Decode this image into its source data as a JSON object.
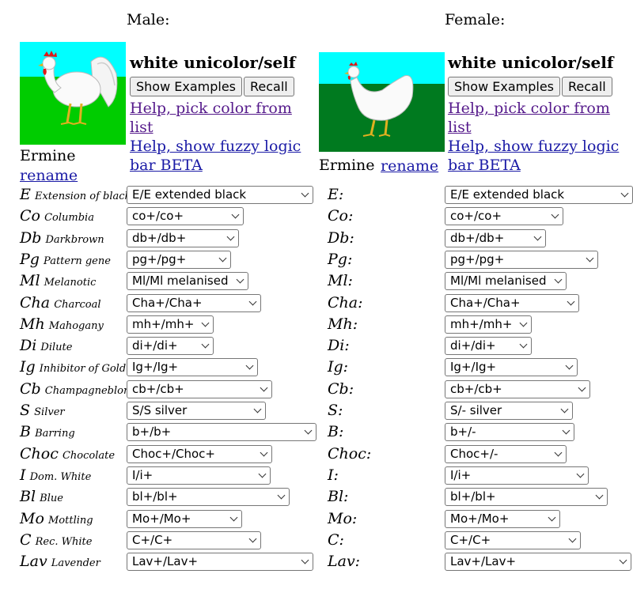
{
  "male": {
    "heading": "Male:",
    "color_name": "white unicolor/self",
    "show_examples": "Show Examples",
    "recall": "Recall",
    "help_pick": "Help, pick color from list",
    "help_fuzzy": "Help, show fuzzy logic bar BETA",
    "name": "Ermine",
    "rename": "rename"
  },
  "female": {
    "heading": "Female:",
    "color_name": "white unicolor/self",
    "show_examples": "Show Examples",
    "recall": "Recall",
    "help_pick": "Help, pick color from list",
    "help_fuzzy": "Help, show fuzzy logic bar BETA",
    "name": "Ermine",
    "rename": "rename"
  },
  "colors": {
    "sky": "#00ffff",
    "grass_male": "#00cc00",
    "grass_female": "#007a1f",
    "link": "#1a1aa6",
    "visited_link": "#551a8b"
  },
  "genes": [
    {
      "symbol": "E",
      "name": "Extension of black",
      "female_label": "E:",
      "male_value": "E/E extended black",
      "female_value": "E/E extended black"
    },
    {
      "symbol": "Co",
      "name": "Columbia",
      "female_label": "Co:",
      "male_value": "co+/co+",
      "female_value": "co+/co+"
    },
    {
      "symbol": "Db",
      "name": "Darkbrown",
      "female_label": "Db:",
      "male_value": "db+/db+",
      "female_value": "db+/db+"
    },
    {
      "symbol": "Pg",
      "name": "Pattern gene",
      "female_label": "Pg:",
      "male_value": "pg+/pg+",
      "female_value": "pg+/pg+"
    },
    {
      "symbol": "Ml",
      "name": "Melanotic",
      "female_label": "Ml:",
      "male_value": "Ml/Ml melanised",
      "female_value": "Ml/Ml melanised"
    },
    {
      "symbol": "Cha",
      "name": "Charcoal",
      "female_label": "Cha:",
      "male_value": "Cha+/Cha+",
      "female_value": "Cha+/Cha+"
    },
    {
      "symbol": "Mh",
      "name": "Mahogany",
      "female_label": "Mh:",
      "male_value": "mh+/mh+",
      "female_value": "mh+/mh+"
    },
    {
      "symbol": "Di",
      "name": "Dilute",
      "female_label": "Di:",
      "male_value": "di+/di+",
      "female_value": "di+/di+"
    },
    {
      "symbol": "Ig",
      "name": "Inhibitor of Gold",
      "female_label": "Ig:",
      "male_value": "Ig+/Ig+",
      "female_value": "Ig+/Ig+"
    },
    {
      "symbol": "Cb",
      "name": "Champagneblond",
      "female_label": "Cb:",
      "male_value": "cb+/cb+",
      "female_value": "cb+/cb+"
    },
    {
      "symbol": "S",
      "name": "Silver",
      "female_label": "S:",
      "male_value": "S/S silver",
      "female_value": "S/- silver"
    },
    {
      "symbol": "B",
      "name": "Barring",
      "female_label": "B:",
      "male_value": "b+/b+",
      "female_value": "b+/-"
    },
    {
      "symbol": "Choc",
      "name": "Chocolate",
      "female_label": "Choc:",
      "male_value": "Choc+/Choc+",
      "female_value": "Choc+/-"
    },
    {
      "symbol": "I",
      "name": "Dom. White",
      "female_label": "I:",
      "male_value": "I/i+",
      "female_value": "I/i+"
    },
    {
      "symbol": "Bl",
      "name": "Blue",
      "female_label": "Bl:",
      "male_value": "bl+/bl+",
      "female_value": "bl+/bl+"
    },
    {
      "symbol": "Mo",
      "name": "Mottling",
      "female_label": "Mo:",
      "male_value": "Mo+/Mo+",
      "female_value": "Mo+/Mo+"
    },
    {
      "symbol": "C",
      "name": "Rec. White",
      "female_label": "C:",
      "male_value": "C+/C+",
      "female_value": "C+/C+"
    },
    {
      "symbol": "Lav",
      "name": "Lavender",
      "female_label": "Lav:",
      "male_value": "Lav+/Lav+",
      "female_value": "Lav+/Lav+"
    }
  ]
}
